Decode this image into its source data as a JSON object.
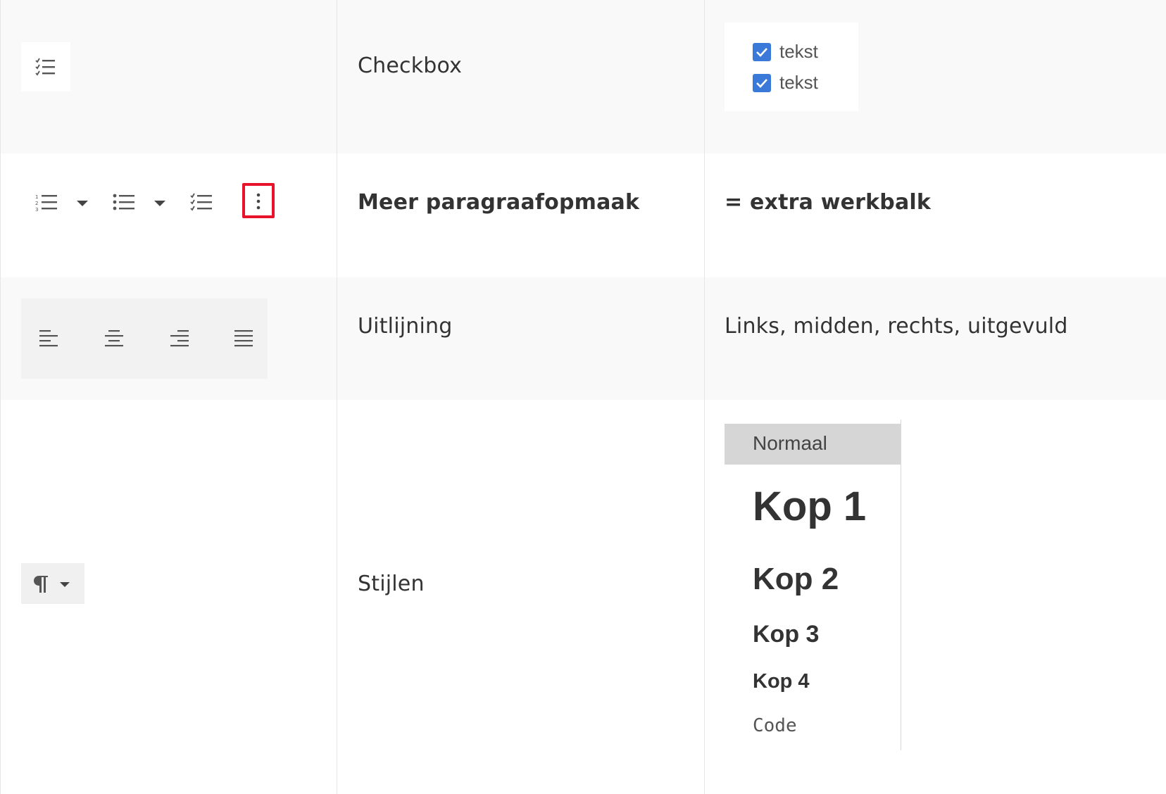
{
  "rows": [
    {
      "name": "Checkbox",
      "description": "",
      "icons": [
        "checklist-icon"
      ],
      "example": {
        "items": [
          "tekst",
          "tekst"
        ]
      }
    },
    {
      "name": "Meer paragraafopmaak",
      "description": "= extra werkbalk",
      "icons": [
        "numbered-list-icon",
        "dropdown-caret-icon",
        "bulleted-list-icon",
        "dropdown-caret-icon",
        "checklist-icon",
        "more-vertical-icon"
      ],
      "highlight_color": "#e8132b"
    },
    {
      "name": "Uitlijning",
      "description": "Links, midden, rechts, uitgevuld",
      "icons": [
        "align-left-icon",
        "align-center-icon",
        "align-right-icon",
        "align-justify-icon"
      ]
    },
    {
      "name": "Stijlen",
      "description": "",
      "icons": [
        "paragraph-icon",
        "dropdown-caret-icon"
      ],
      "styles": [
        "Normaal",
        "Kop 1",
        "Kop 2",
        "Kop 3",
        "Kop 4",
        "Code"
      ]
    }
  ],
  "colors": {
    "shaded_row": "#f9f9f9",
    "checkbox_blue": "#3a79d8",
    "selected_style": "#d6d6d6"
  }
}
